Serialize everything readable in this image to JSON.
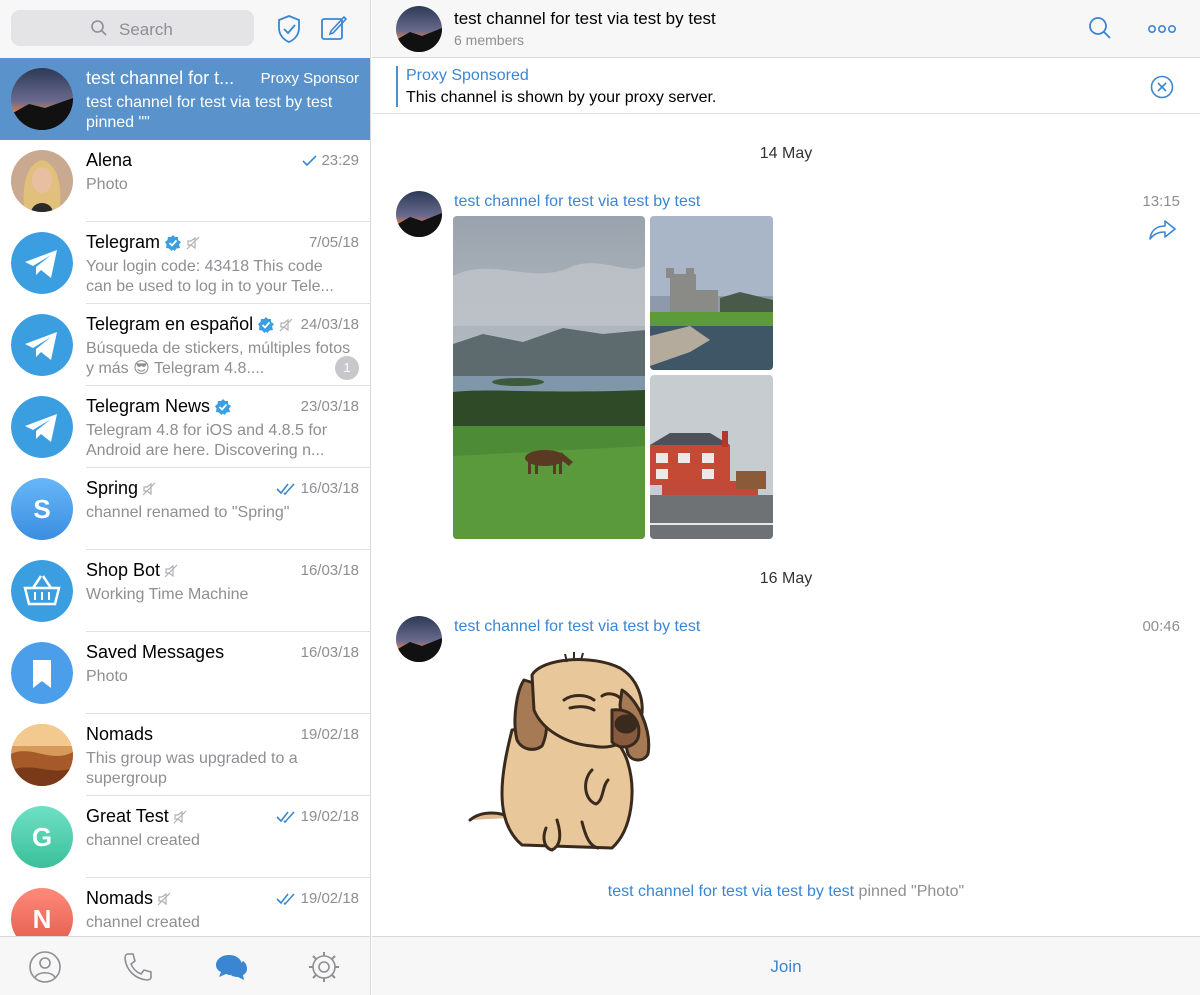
{
  "colors": {
    "accent": "#3a86d3",
    "active_row": "#5a93cc",
    "muted_text": "#8e8e93"
  },
  "search": {
    "placeholder": "Search"
  },
  "chats": [
    {
      "name": "test channel for t...",
      "date": "Proxy Sponsor",
      "preview": "test channel for test via test by test pinned \"\"",
      "avatar": "mountain-sunset",
      "active": true
    },
    {
      "name": "Alena",
      "date": "23:29",
      "preview": "Photo",
      "avatar": "portrait",
      "read": "single"
    },
    {
      "name": "Telegram",
      "date": "7/05/18",
      "preview": "Your login code: 43418  This code can be used to log in to your Tele...",
      "avatar": "telegram",
      "verified": true,
      "muted": true
    },
    {
      "name": "Telegram en español",
      "date": "24/03/18",
      "preview": "Búsqueda de stickers, múltiples fotos y más 😎  Telegram 4.8....",
      "avatar": "telegram",
      "verified": true,
      "muted": true,
      "unread": "1"
    },
    {
      "name": "Telegram News",
      "date": "23/03/18",
      "preview": "Telegram 4.8 for iOS and 4.8.5 for Android are here.   Discovering n...",
      "avatar": "telegram",
      "verified": true
    },
    {
      "name": "Spring",
      "date": "16/03/18",
      "preview": "channel renamed to \"Spring\"",
      "avatar": "letter",
      "letter": "S",
      "muted": true,
      "read": "double"
    },
    {
      "name": "Shop Bot",
      "date": "16/03/18",
      "preview": "Working Time Machine",
      "avatar": "basket",
      "muted": true
    },
    {
      "name": "Saved Messages",
      "date": "16/03/18",
      "preview": "Photo",
      "avatar": "bookmark"
    },
    {
      "name": "Nomads",
      "date": "19/02/18",
      "preview": "This group was upgraded to a supergroup",
      "avatar": "desert"
    },
    {
      "name": "Great Test",
      "date": "19/02/18",
      "preview": "channel created",
      "avatar": "letter",
      "letter": "G",
      "muted": true,
      "read": "double"
    },
    {
      "name": "Nomads",
      "date": "19/02/18",
      "preview": "channel created",
      "avatar": "letter",
      "letter": "N",
      "muted": true,
      "read": "double"
    }
  ],
  "tabs": [
    "contacts-icon",
    "calls-icon",
    "chats-icon",
    "settings-icon"
  ],
  "header": {
    "title": "test channel for test via test by test",
    "subtitle": "6 members"
  },
  "proxy": {
    "title": "Proxy Sponsored",
    "text": "This channel is shown by your proxy server."
  },
  "messages": {
    "date1": "14 May",
    "msg1": {
      "author": "test channel for test via test by test",
      "time": "13:15"
    },
    "date2": "16 May",
    "msg2": {
      "author": "test channel for test via test by test",
      "time": "00:46"
    }
  },
  "service": {
    "author": "test channel for test via test by test",
    "text": " pinned \"Photo\""
  },
  "footer": {
    "join_label": "Join"
  }
}
